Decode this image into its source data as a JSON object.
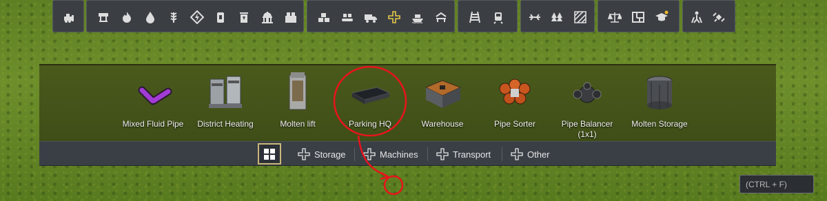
{
  "buildings": [
    {
      "label": "Mixed Fluid Pipe",
      "icon": "mixed-fluid-pipe-icon"
    },
    {
      "label": "District Heating",
      "icon": "district-heating-icon"
    },
    {
      "label": "Molten lift",
      "icon": "molten-lift-icon"
    },
    {
      "label": "Parking HQ",
      "icon": "parking-hq-icon"
    },
    {
      "label": "Warehouse",
      "icon": "warehouse-icon"
    },
    {
      "label": "Pipe Sorter",
      "icon": "pipe-sorter-icon"
    },
    {
      "label": "Pipe Balancer\n(1x1)",
      "icon": "pipe-balancer-icon"
    },
    {
      "label": "Molten Storage",
      "icon": "molten-storage-icon"
    }
  ],
  "categories": [
    {
      "label": "Storage"
    },
    {
      "label": "Machines"
    },
    {
      "label": "Transport"
    },
    {
      "label": "Other"
    }
  ],
  "search": {
    "placeholder": "(CTRL + F)"
  },
  "colors": {
    "highlight_circle": "#e8141c",
    "active_plus": "#e7c84a"
  }
}
